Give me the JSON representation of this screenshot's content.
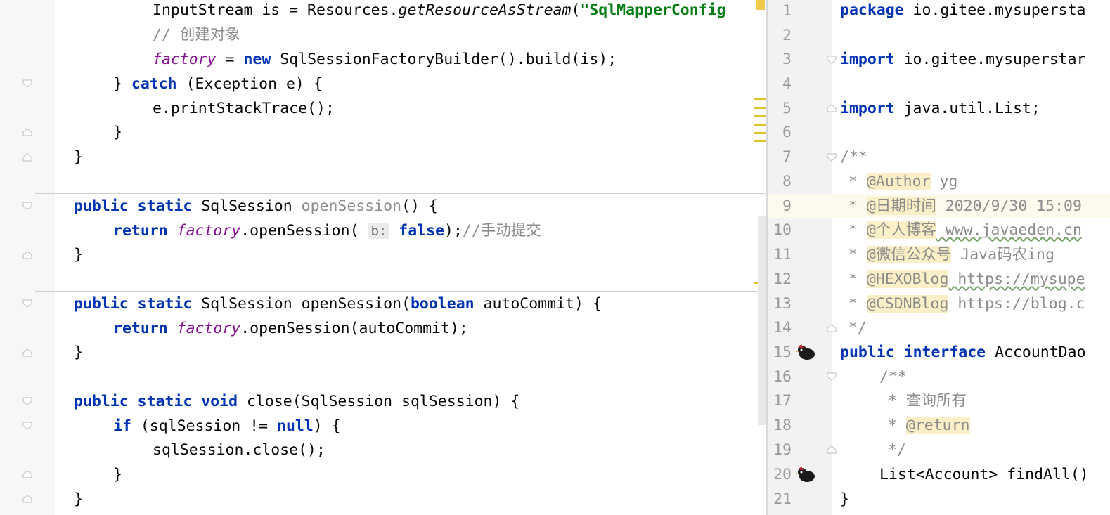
{
  "left_editor": {
    "lines": [
      "InputStream is = Resources.getResourceAsStream(\"SqlMapperConfig",
      "// 创建对象",
      "factory = new SqlSessionFactoryBuilder().build(is);",
      "} catch (Exception e) {",
      "e.printStackTrace();",
      "}",
      "}",
      "public static SqlSession openSession() {",
      "return factory.openSession( b: false);//手动提交",
      "}",
      "public static SqlSession openSession(boolean autoCommit) {",
      "return factory.openSession(autoCommit);",
      "}",
      "public static void close(SqlSession sqlSession) {",
      "if (sqlSession != null) {",
      "sqlSession.close();",
      "}",
      "}"
    ],
    "param_hint": "b:"
  },
  "right_editor": {
    "line_numbers": [
      "1",
      "2",
      "3",
      "4",
      "5",
      "6",
      "7",
      "8",
      "9",
      "10",
      "11",
      "12",
      "13",
      "14",
      "15",
      "16",
      "17",
      "18",
      "19",
      "20",
      "21"
    ],
    "current_line": "9",
    "lines": {
      "l1": "package io.gitee.mysupersta",
      "l3": "import io.gitee.mysuperstar",
      "l5": "import java.util.List;",
      "l7": "/**",
      "l8_tag": "@Author",
      "l8_val": " yg",
      "l9_tag": "@日期时间",
      "l9_val": " 2020/9/30 15:09",
      "l10_tag": "@个人博客",
      "l10_val": " www.javaeden.cn",
      "l11_tag": "@微信公众号",
      "l11_val": " Java码农ing",
      "l12_tag": "@HEXOBlog",
      "l12_val": " https://mysupe",
      "l13_tag": "@CSDNBlog",
      "l13_val": " https://blog.c",
      "l14": "*/",
      "l15": "public interface AccountDao",
      "l16": "/**",
      "l17": "* 查询所有",
      "l18_tag": "@return",
      "l19": "*/",
      "l20": "List<Account> findAll()",
      "l21": "}"
    }
  },
  "colors": {
    "keyword": "#0033b3",
    "field": "#871094",
    "string": "#067d17",
    "comment": "#8c8c8c",
    "doc_tag_bg": "#fbefc8",
    "current_line_bg": "#fcfaed"
  },
  "icons": [
    "fold-icon",
    "mybatis-bird-icon",
    "warning-marker"
  ]
}
